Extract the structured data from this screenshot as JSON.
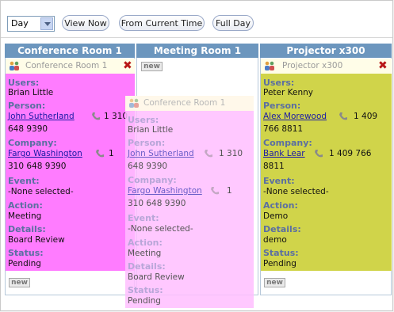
{
  "toolbar": {
    "view_select": "Day",
    "buttons": [
      "View Now",
      "From Current Time",
      "Full Day"
    ]
  },
  "columns": [
    "Conference Room 1",
    "Meeting Room 1",
    "Projector x300"
  ],
  "new_label": "new",
  "labels": {
    "users": "Users:",
    "person": "Person:",
    "company": "Company:",
    "event": "Event:",
    "action": "Action:",
    "details": "Details:",
    "status": "Status:"
  },
  "bookings": [
    {
      "title": "Conference Room 1",
      "users": "Brian Little",
      "person": "John Sutherland",
      "person_phone_a": "1 310",
      "person_phone_b": "648 9390",
      "company": "Fargo Washington",
      "company_phone_a": "1",
      "company_phone_b": "310 648 9390",
      "event": "-None selected-",
      "action": "Meeting",
      "details": "Board Review",
      "status": "Pending"
    },
    {
      "title": "Conference Room 1",
      "users": "Brian Little",
      "person": "John Sutherland",
      "person_phone_a": "1 310",
      "person_phone_b": "648 9390",
      "company": "Fargo Washington",
      "company_phone_a": "1",
      "company_phone_b": "310 648 9390",
      "event": "-None selected-",
      "action": "Meeting",
      "details": "Board Review",
      "status": "Pending"
    },
    {
      "title": "Projector x300",
      "users": "Peter Kenny",
      "person": "Alex Morewood",
      "person_phone_a": "1 409",
      "person_phone_b": "766 8811",
      "company": "Bank Lear",
      "company_phone_a": "1 409 766",
      "company_phone_b": "8811",
      "event": "-None selected-",
      "action": "Demo",
      "details": "demo",
      "status": "Pending"
    }
  ],
  "colors": {
    "header": "#6c96be",
    "magenta": "#ff7cff",
    "light_magenta": "#ffc8ff",
    "yellow_green": "#d0d44a",
    "label": "#5b6fa1"
  }
}
